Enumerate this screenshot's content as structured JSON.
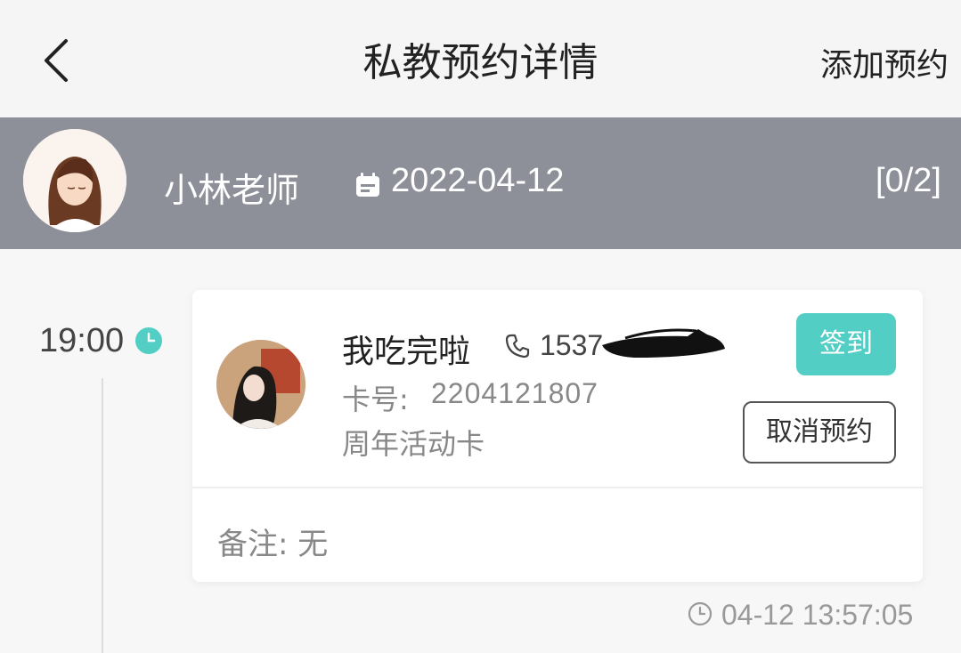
{
  "nav": {
    "back_icon": "chevron-left-icon",
    "title": "私教预约详情",
    "action_label": "添加预约"
  },
  "coach": {
    "name": "小林老师",
    "date_icon": "calendar-icon",
    "date": "2022-04-12",
    "count": "[0/2]"
  },
  "slot": {
    "time": "19:00",
    "time_icon": "clock-icon",
    "accent_color": "#52CEC5"
  },
  "booking": {
    "member_name": "我吃完啦",
    "phone_icon": "phone-icon",
    "phone_visible": "1537",
    "card_number_label": "卡号:",
    "card_number": "2204121807",
    "card_type": "周年活动卡",
    "checkin_label": "签到",
    "cancel_label": "取消预约",
    "remark": "备注: 无",
    "created_at": "04-12 13:57:05"
  }
}
